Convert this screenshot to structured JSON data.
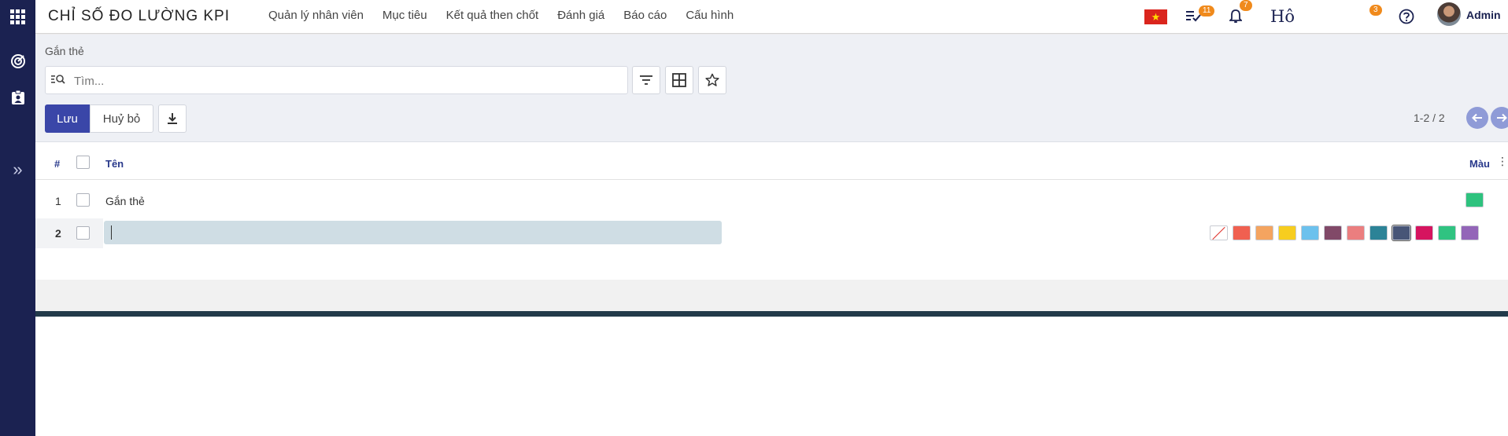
{
  "app": {
    "title": "CHỈ SỐ ĐO LƯỜNG KPI",
    "menu": [
      "Quản lý nhân viên",
      "Mục tiêu",
      "Kết quả then chốt",
      "Đánh giá",
      "Báo cáo",
      "Cấu hình"
    ]
  },
  "systray": {
    "flag": "★",
    "activities_count": "11",
    "notifications_count": "7",
    "ho_text": "Hô",
    "extra_count": "3",
    "user_name": "Admin"
  },
  "control": {
    "breadcrumb": "Gắn thẻ",
    "search_placeholder": "Tìm...",
    "save_label": "Lưu",
    "cancel_label": "Huỷ bỏ",
    "pager": "1-2 / 2"
  },
  "list": {
    "headers": {
      "index": "#",
      "name": "Tên",
      "color": "Màu"
    },
    "rows": [
      {
        "index": "1",
        "name": "Gắn thẻ",
        "color": "#2ec27e"
      },
      {
        "index": "2",
        "name": "",
        "editing": true
      }
    ]
  },
  "palette": {
    "colors": [
      "none",
      "#f06050",
      "#f4a460",
      "#f7cd1f",
      "#6cc1ed",
      "#814968",
      "#eb7e7f",
      "#2c8397",
      "#475577",
      "#d6145f",
      "#30c381",
      "#9365b8"
    ],
    "selected_index": 8
  }
}
